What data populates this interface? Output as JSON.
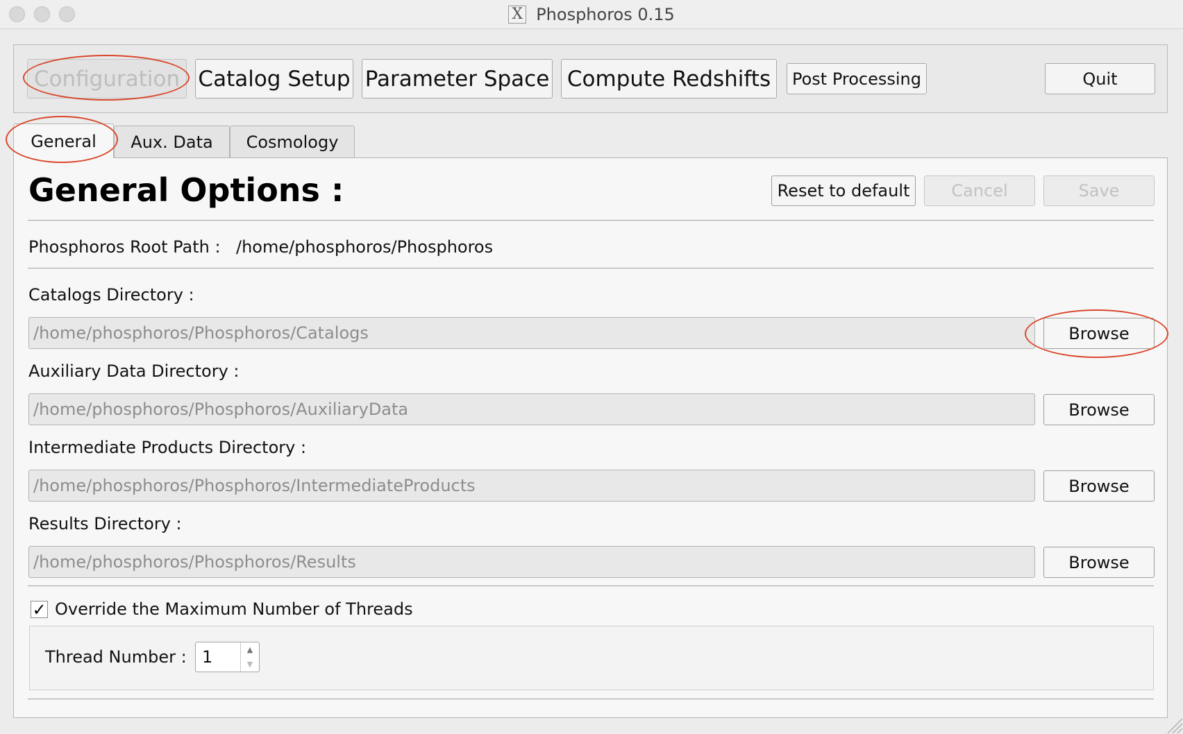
{
  "window": {
    "title": "Phosphoros 0.15",
    "x_icon_glyph": "X"
  },
  "toolbar": {
    "configuration": "Configuration",
    "catalog_setup": "Catalog Setup",
    "parameter_space": "Parameter Space",
    "compute_redshifts": "Compute Redshifts",
    "post_processing": "Post Processing",
    "quit": "Quit"
  },
  "tabs": {
    "general": "General",
    "aux_data": "Aux. Data",
    "cosmology": "Cosmology"
  },
  "general": {
    "heading": "General Options :",
    "reset_label": "Reset to default",
    "cancel_label": "Cancel",
    "save_label": "Save",
    "root_path_label": "Phosphoros Root Path  :",
    "root_path_value": "/home/phosphoros/Phosphoros",
    "directories": [
      {
        "label": "Catalogs Directory :",
        "value": "/home/phosphoros/Phosphoros/Catalogs",
        "button": "Browse"
      },
      {
        "label": "Auxiliary Data Directory :",
        "value": "/home/phosphoros/Phosphoros/AuxiliaryData",
        "button": "Browse"
      },
      {
        "label": "Intermediate Products Directory :",
        "value": "/home/phosphoros/Phosphoros/IntermediateProducts",
        "button": "Browse"
      },
      {
        "label": "Results Directory :",
        "value": "/home/phosphoros/Phosphoros/Results",
        "button": "Browse"
      }
    ],
    "override_threads_label": "Override the Maximum Number of Threads",
    "override_threads_checked": true,
    "check_glyph": "✓",
    "thread_number_label": "Thread Number :",
    "thread_number_value": "1"
  },
  "colors": {
    "annotation": "#d9472b"
  }
}
